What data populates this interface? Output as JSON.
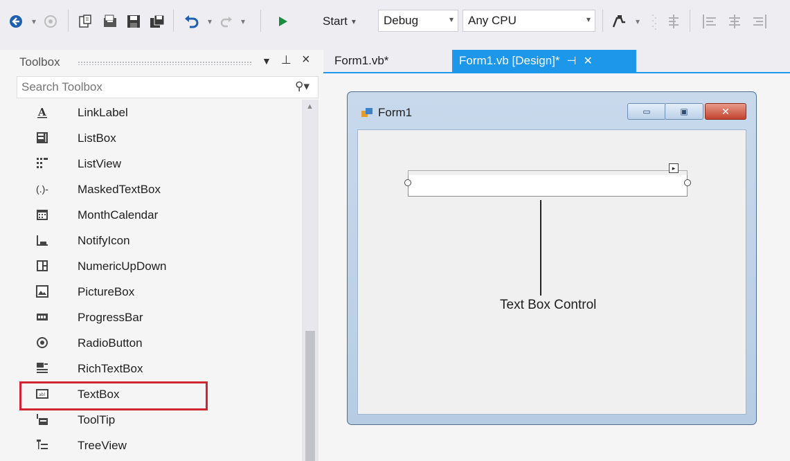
{
  "toolbar": {
    "start_label": "Start",
    "config_value": "Debug",
    "platform_value": "Any CPU",
    "icons": [
      "back-icon",
      "forward-icon",
      "new-project-icon",
      "open-file-icon",
      "save-icon",
      "save-all-icon",
      "undo-icon",
      "redo-icon",
      "start-icon",
      "find-icon",
      "align-icon"
    ]
  },
  "toolbox": {
    "title": "Toolbox",
    "search_placeholder": "Search Toolbox",
    "items": [
      {
        "label": "LinkLabel",
        "icon": "link-label-icon"
      },
      {
        "label": "ListBox",
        "icon": "listbox-icon"
      },
      {
        "label": "ListView",
        "icon": "listview-icon"
      },
      {
        "label": "MaskedTextBox",
        "icon": "masked-textbox-icon"
      },
      {
        "label": "MonthCalendar",
        "icon": "calendar-icon"
      },
      {
        "label": "NotifyIcon",
        "icon": "notify-icon"
      },
      {
        "label": "NumericUpDown",
        "icon": "numeric-updown-icon"
      },
      {
        "label": "PictureBox",
        "icon": "picture-icon"
      },
      {
        "label": "ProgressBar",
        "icon": "progressbar-icon"
      },
      {
        "label": "RadioButton",
        "icon": "radio-button-icon"
      },
      {
        "label": "RichTextBox",
        "icon": "richtextbox-icon"
      },
      {
        "label": "TextBox",
        "icon": "textbox-icon"
      },
      {
        "label": "ToolTip",
        "icon": "tooltip-icon"
      },
      {
        "label": "TreeView",
        "icon": "treeview-icon"
      }
    ],
    "highlighted_item": "TextBox"
  },
  "tabs": [
    {
      "label": "Form1.vb*",
      "active": false
    },
    {
      "label": "Form1.vb [Design]*",
      "active": true
    }
  ],
  "form": {
    "title": "Form1",
    "annotation": "Text Box Control"
  },
  "colors": {
    "accent": "#1c97ea",
    "highlight_border": "#d1252f",
    "start_green": "#1c8c3c"
  }
}
